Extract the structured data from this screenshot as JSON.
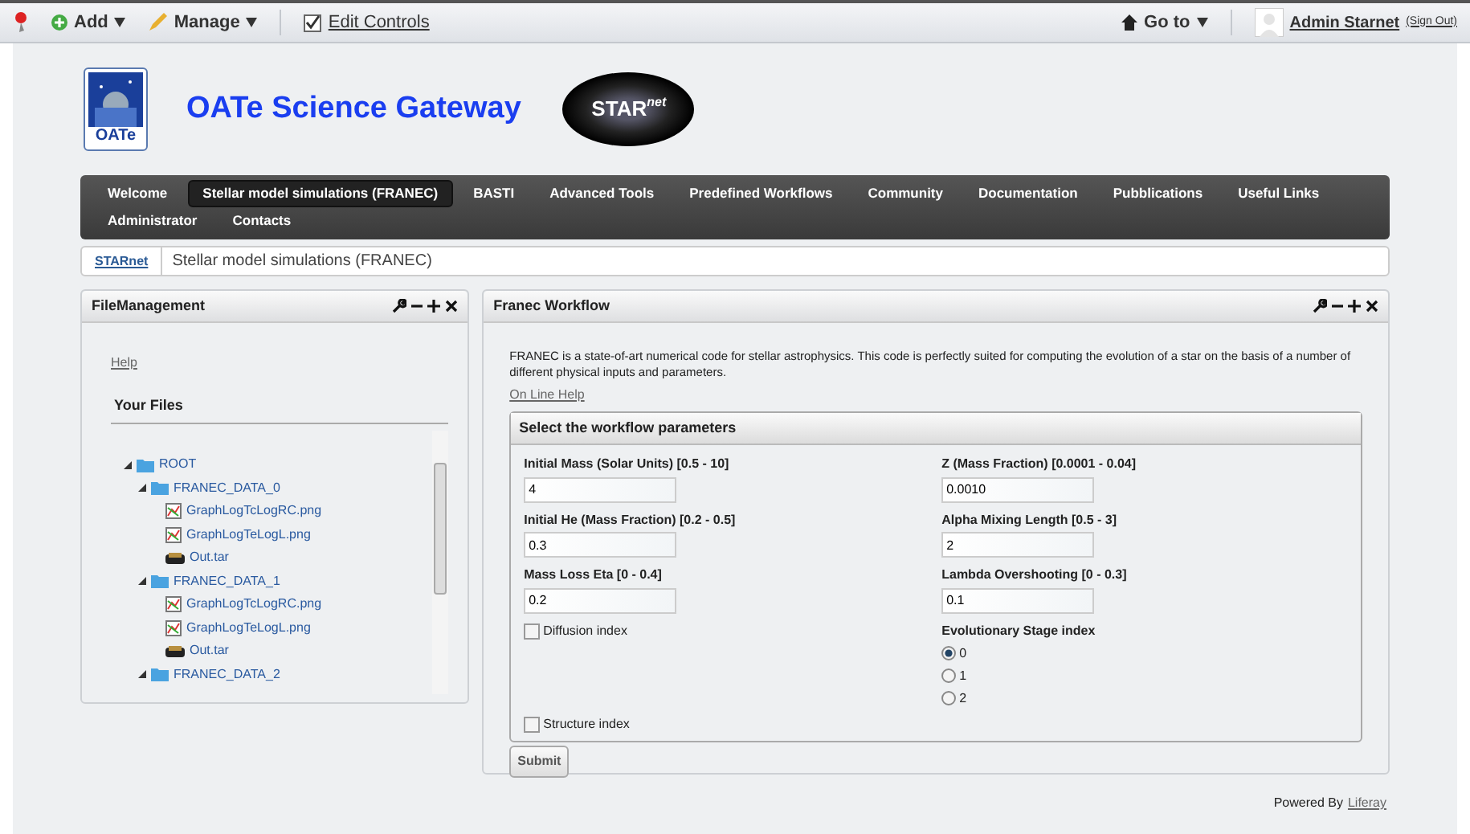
{
  "dockbar": {
    "left": [
      {
        "kind": "pin"
      },
      {
        "kind": "add",
        "label": "Add"
      },
      {
        "kind": "manage",
        "label": "Manage"
      },
      {
        "kind": "toggle",
        "label": "Edit Controls",
        "checked": true
      }
    ],
    "goto": "Go to",
    "user": "Admin Starnet",
    "signout": "(Sign Out)"
  },
  "header": {
    "title": "OATe Science Gateway",
    "logo_text": "OATe",
    "badge_text": "STAR",
    "badge_sup": "net"
  },
  "nav": [
    {
      "label": "Welcome",
      "selected": false
    },
    {
      "label": "Stellar model simulations (FRANEC)",
      "selected": true
    },
    {
      "label": "BASTI",
      "selected": false
    },
    {
      "label": "Advanced Tools",
      "selected": false
    },
    {
      "label": "Predefined Workflows",
      "selected": false
    },
    {
      "label": "Community",
      "selected": false
    },
    {
      "label": "Documentation",
      "selected": false
    },
    {
      "label": "Pubblications",
      "selected": false
    },
    {
      "label": "Useful Links",
      "selected": false
    },
    {
      "label": "Administrator",
      "selected": false
    },
    {
      "label": "Contacts",
      "selected": false
    }
  ],
  "breadcrumb": [
    "STARnet",
    "Stellar model simulations (FRANEC)"
  ],
  "file_portlet": {
    "title": "FileManagement",
    "help": "Help",
    "files_heading": "Your Files",
    "tree": [
      {
        "label": "ROOT",
        "kind": "folder",
        "expanded": true,
        "children": [
          {
            "label": "FRANEC_DATA_0",
            "kind": "folder",
            "expanded": true,
            "children": [
              {
                "label": "GraphLogTcLogRC.png",
                "kind": "image"
              },
              {
                "label": "GraphLogTeLogL.png",
                "kind": "image"
              },
              {
                "label": "Out.tar",
                "kind": "archive"
              }
            ]
          },
          {
            "label": "FRANEC_DATA_1",
            "kind": "folder",
            "expanded": true,
            "children": [
              {
                "label": "GraphLogTcLogRC.png",
                "kind": "image"
              },
              {
                "label": "GraphLogTeLogL.png",
                "kind": "image"
              },
              {
                "label": "Out.tar",
                "kind": "archive"
              }
            ]
          },
          {
            "label": "FRANEC_DATA_2",
            "kind": "folder",
            "expanded": true
          }
        ]
      }
    ]
  },
  "workflow_portlet": {
    "title": "Franec Workflow",
    "description": "FRANEC is a state-of-art numerical code for stellar astrophysics. This code is perfectly suited for computing the evolution of a star on the basis of a number of different physical inputs and parameters.",
    "help_link": "On Line Help",
    "section_title": "Select the workflow parameters",
    "rows": [
      [
        {
          "kind": "text",
          "label": "Initial Mass (Solar Units) [0.5 - 10]",
          "value": "4"
        },
        {
          "kind": "text",
          "label": "Z (Mass Fraction) [0.0001 - 0.04]",
          "value": "0.0010"
        }
      ],
      [
        {
          "kind": "text",
          "label": "Initial He (Mass Fraction) [0.2 - 0.5]",
          "value": "0.3"
        },
        {
          "kind": "text",
          "label": "Alpha Mixing Length [0.5 - 3]",
          "value": "2"
        }
      ],
      [
        {
          "kind": "text",
          "label": "Mass Loss Eta [0 - 0.4]",
          "value": "0.2"
        },
        {
          "kind": "text",
          "label": "Lambda Overshooting [0 - 0.3]",
          "value": "0.1"
        }
      ],
      [
        {
          "kind": "checkbox",
          "label": "Diffusion index",
          "checked": false
        },
        {
          "kind": "radio",
          "label": "Evolutionary Stage index",
          "options": [
            {
              "label": "0",
              "selected": true
            },
            {
              "label": "1",
              "selected": false
            },
            {
              "label": "2",
              "selected": false
            }
          ]
        }
      ],
      [
        {
          "kind": "checkbox",
          "label": "Structure index",
          "checked": false
        }
      ]
    ],
    "submit": "Submit"
  },
  "footer": {
    "text": "Powered By",
    "link": "Liferay"
  }
}
